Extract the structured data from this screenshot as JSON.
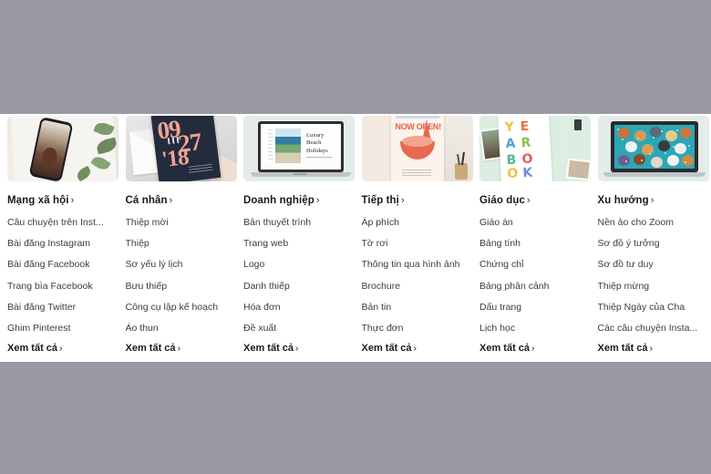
{
  "theme": {
    "chrome_gray": "#9a9aa4",
    "panel_bg": "#ffffff",
    "heading_color": "#1a1a1a",
    "link_color": "#3d3d3d"
  },
  "menu": {
    "see_all_label": "Xem tất cả",
    "chevron": "›",
    "columns": [
      {
        "id": "mang-xa-hoi",
        "title": "Mạng xã hội",
        "thumbnail_alt": "phone-on-cloth-with-leaves",
        "links": [
          "Câu chuyện trên Inst...",
          "Bài đăng Instagram",
          "Bài đăng Facebook",
          "Trang bìa Facebook",
          "Bài đăng Twitter",
          "Ghim Pinterest"
        ]
      },
      {
        "id": "ca-nhan",
        "title": "Cá nhân",
        "thumbnail_alt": "navy-invitation-card-09-27-18",
        "links": [
          "Thiệp mời",
          "Thiệp",
          "Sơ yếu lý lịch",
          "Bưu thiếp",
          "Công cụ lập kế hoạch",
          "Áo thun"
        ]
      },
      {
        "id": "doanh-nghiep",
        "title": "Doanh nghiệp",
        "thumbnail_alt": "laptop-luxury-beach-holidays",
        "links": [
          "Bản thuyết trình",
          "Trang web",
          "Logo",
          "Danh thiếp",
          "Hóa đơn",
          "Đề xuất"
        ]
      },
      {
        "id": "tiep-thi",
        "title": "Tiếp thị",
        "thumbnail_alt": "now-open-poster",
        "links": [
          "Áp phích",
          "Tờ rơi",
          "Thông tin qua hình ảnh",
          "Brochure",
          "Bản tin",
          "Thực đơn"
        ]
      },
      {
        "id": "giao-duc",
        "title": "Giáo dục",
        "thumbnail_alt": "yearbook-cover",
        "links": [
          "Giáo án",
          "Bảng tính",
          "Chứng chỉ",
          "Bảng phân cảnh",
          "Dấu trang",
          "Lịch học"
        ]
      },
      {
        "id": "xu-huong",
        "title": "Xu hướng",
        "thumbnail_alt": "laptop-zoom-dog-background",
        "links": [
          "Nền ảo cho Zoom",
          "Sơ đồ ý tưởng",
          "Sơ đồ tư duy",
          "Thiệp mừng",
          "Thiệp Ngày của Cha",
          "Các câu chuyện Insta..."
        ]
      }
    ]
  },
  "thumbnail_text": {
    "card_day": "09",
    "card_month": "27",
    "card_year": "'18",
    "presentation_title": "Luxury Beach Holidays",
    "poster_headline": "NOW OPEN!",
    "yearbook_letters": [
      "Y",
      "E",
      "A",
      "R",
      "B",
      "O",
      "O",
      "K"
    ]
  }
}
